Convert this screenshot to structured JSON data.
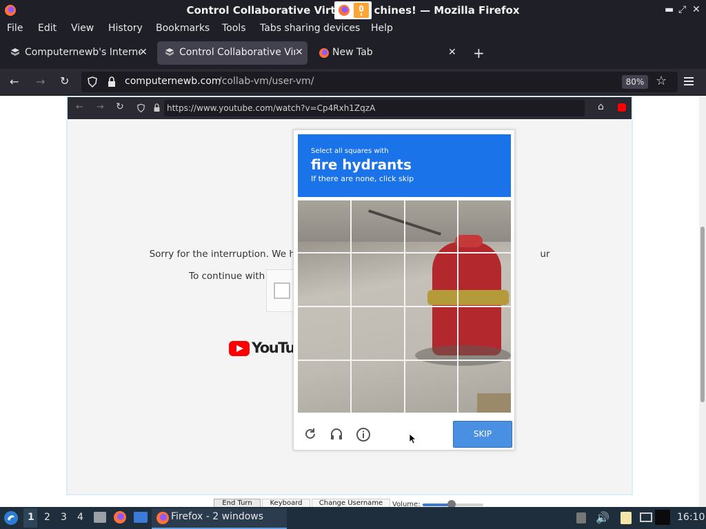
{
  "window": {
    "title": "Control Collaborative Virtual Machines! — Mozilla Firefox",
    "title_visible": "Control Collaborative Virt",
    "title_visible_end": "chines! — Mozilla Firefox"
  },
  "menu": {
    "items": [
      "File",
      "Edit",
      "View",
      "History",
      "Bookmarks",
      "Tools",
      "Tabs sharing devices",
      "Help"
    ]
  },
  "tabs": [
    {
      "label": "Computernewb's Interne"
    },
    {
      "label": "Control Collaborative Virt"
    },
    {
      "label": "New Tab"
    }
  ],
  "navbar": {
    "url_domain": "computernewb.com",
    "url_path": "/collab-vm/user-vm/",
    "zoom": "80%"
  },
  "vm": {
    "inner_url": "https://www.youtube.com/watch?v=Cp4Rxh1ZqzA",
    "sorry_line1": "Sorry for the interruption. We have b",
    "sorry_line1_end": "ur network.",
    "sorry_line2": "To continue with your Yo",
    "youtube_logo": "YouTube"
  },
  "captcha": {
    "instruction_small": "Select all squares with",
    "target": "fire hydrants",
    "subtext": "If there are none, click skip",
    "skip_label": "SKIP"
  },
  "vm_toolbar": {
    "end_turn": "End Turn",
    "keyboard": "Keyboard",
    "change_username": "Change Username",
    "volume_label": "Volume:"
  },
  "taskbar": {
    "workspaces": [
      "1",
      "2",
      "3",
      "4"
    ],
    "firefox_label": "Firefox - 2 windows",
    "clock": "16:10"
  },
  "colors": {
    "chrome_dark": "#1f1f27",
    "captcha_blue": "#1a73e8",
    "skip_blue": "#4a90e2",
    "hydrant_red": "#b3282c",
    "youtube_red": "#ff0000"
  }
}
